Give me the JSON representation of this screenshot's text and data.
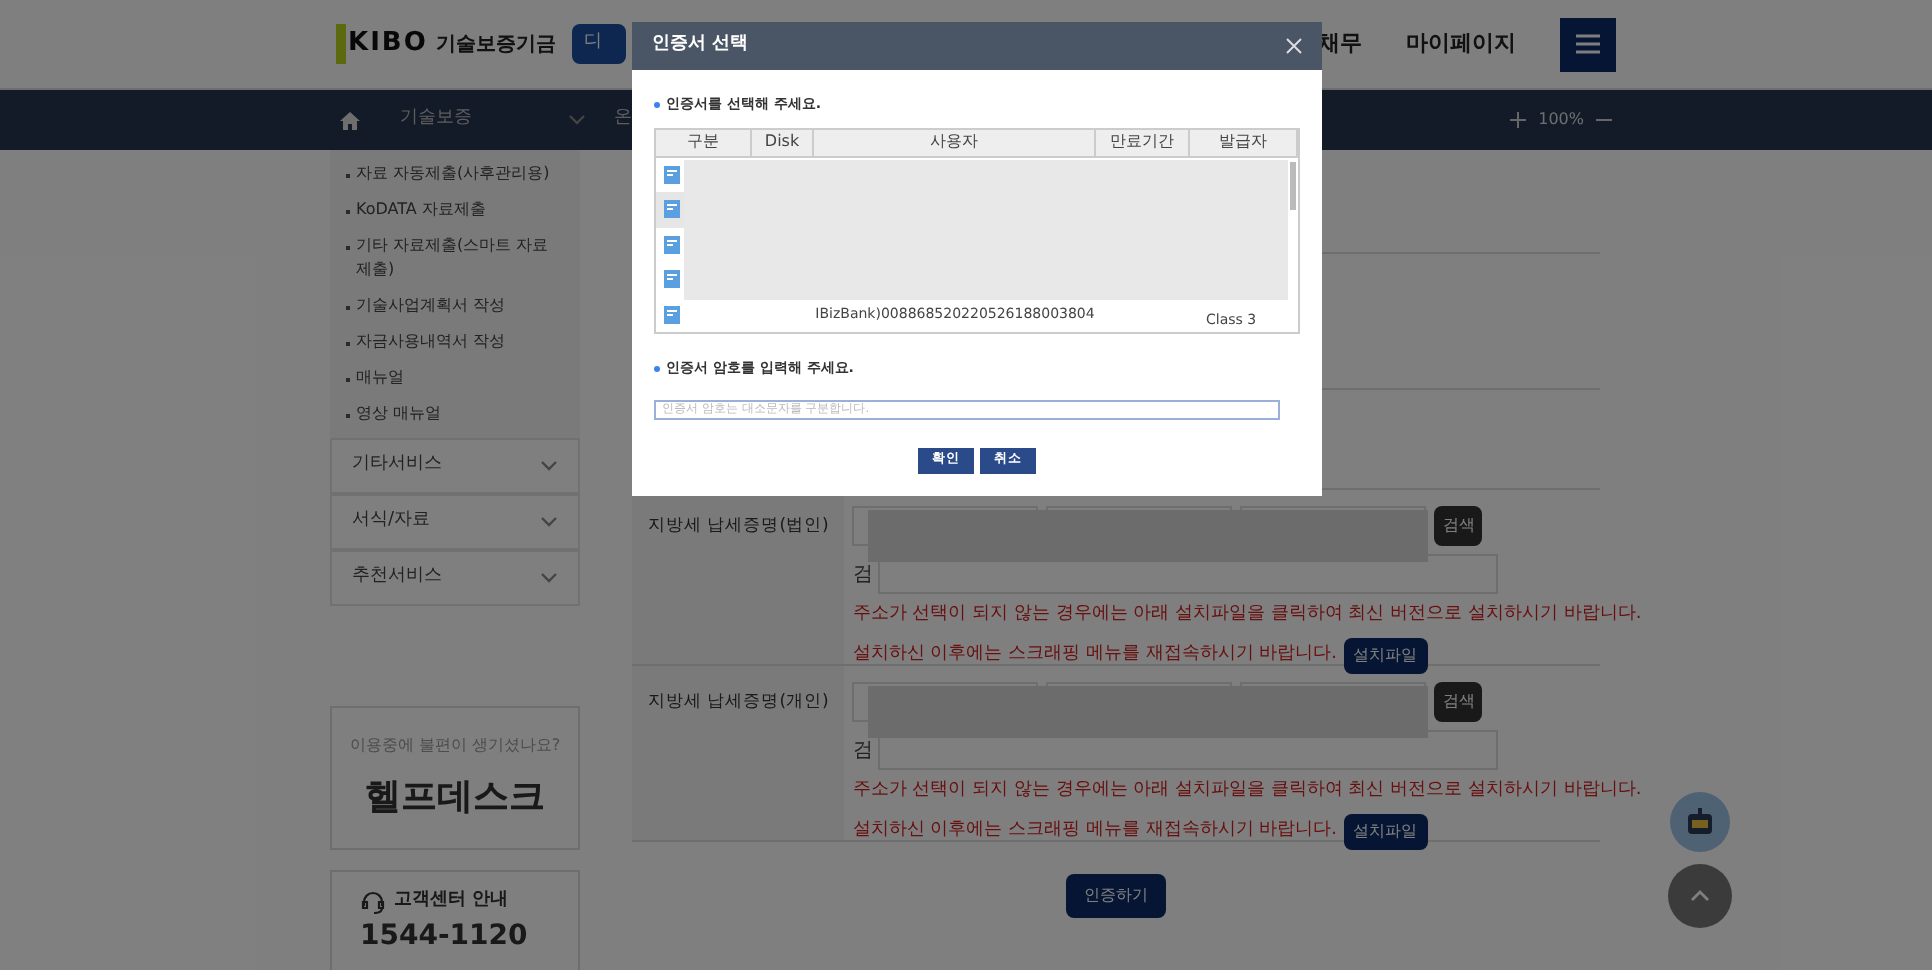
{
  "header": {
    "logo": "KIBO",
    "org_name": "기술보증기금",
    "badge": "디",
    "nav": [
      "채무",
      "마이페이지"
    ]
  },
  "navbar": {
    "crumbs": [
      "기술보증",
      "온"
    ],
    "zoom": "100%"
  },
  "sidebar": {
    "submenu": [
      "자료 자동제출(사후관리용)",
      "KoDATA 자료제출",
      "기타 자료제출(스마트 자료제출)",
      "기술사업계획서 작성",
      "자금사용내역서 작성",
      "매뉴얼",
      "영상 매뉴얼"
    ],
    "sections": [
      {
        "label": "기타서비스",
        "expanded": false
      },
      {
        "label": "서식/자료",
        "expanded": false
      },
      {
        "label": "추천서비스",
        "expanded": false
      }
    ],
    "helpdesk": {
      "subtitle": "이용중에 불편이 생기셨나요?",
      "title": "헬프데스크"
    },
    "contact": {
      "title": "고객센터 안내",
      "phone": "1544-1120"
    }
  },
  "form": {
    "rows": [
      {
        "label": "지방세 납세증명(법인)",
        "search_button": "검색",
        "field_label": "검",
        "notice": "주소가 선택이 되지 않는 경우에는 아래 설치파일을 클릭하여 최신 버전으로 설치하시기 바랍니다.",
        "notice2": "설치하신 이후에는 스크래핑 메뉴를 재접속하시기 바랍니다.",
        "install_button": "설치파일"
      },
      {
        "label": "지방세 납세증명(개인)",
        "search_button": "검색",
        "field_label": "검",
        "notice": "주소가 선택이 되지 않는 경우에는 아래 설치파일을 클릭하여 최신 버전으로 설치하시기 바랍니다.",
        "notice2": "설치하신 이후에는 스크래핑 메뉴를 재접속하시기 바랍니다.",
        "install_button": "설치파일"
      }
    ],
    "submit": "인증하기"
  },
  "dialog": {
    "title": "인증서 선택",
    "cert_prompt": "인증서를 선택해 주세요.",
    "columns": [
      "구분",
      "Disk",
      "사용자",
      "만료기간",
      "발급자"
    ],
    "rows": [
      {
        "selected": false
      },
      {
        "selected": true
      },
      {
        "selected": false
      },
      {
        "selected": false
      },
      {
        "selected": false,
        "user": "IBizBank)008868520220526188003804",
        "issuer": "Class 3"
      }
    ],
    "password_prompt": "인증서 암호를 입력해 주세요.",
    "password_placeholder": "인증서 암호는 대소문자를 구분합니다.",
    "buttons": [
      "확인",
      "취소"
    ]
  }
}
